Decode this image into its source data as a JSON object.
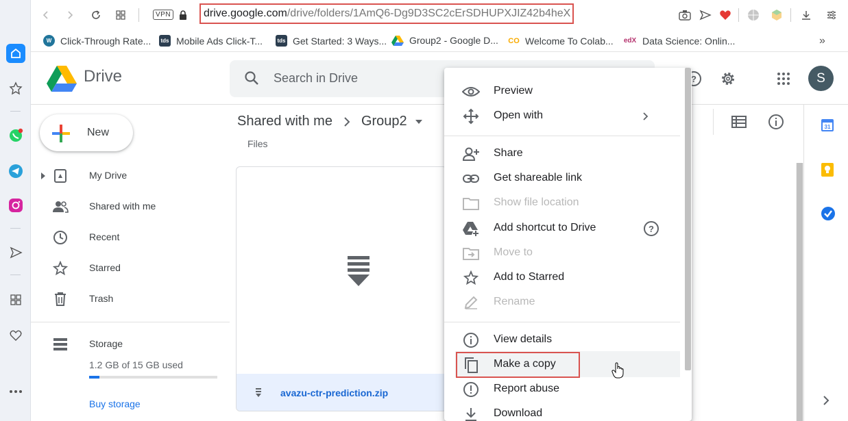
{
  "browser": {
    "url_domain": "drive.google.com",
    "url_path": "/drive/folders/1AmQ6-Dg9D3SC2cErSDHUPXJIZ42b4heX",
    "vpn_label": "VPN",
    "bookmarks": [
      {
        "label": "Click-Through Rate...",
        "icon": "wordpress-icon",
        "color": "#21759b"
      },
      {
        "label": "Mobile Ads Click-T...",
        "icon": "tds-icon",
        "color": "#2c3e50",
        "badge": "tds"
      },
      {
        "label": "Get Started: 3 Ways...",
        "icon": "tds-icon",
        "color": "#2c3e50",
        "badge": "tds"
      },
      {
        "label": "Group2 - Google D...",
        "icon": "google-drive-icon",
        "color": "#0f9d58"
      },
      {
        "label": "Welcome To Colab...",
        "icon": "colab-icon",
        "color": "#f9ab00",
        "badge": "CO"
      },
      {
        "label": "Data Science: Onlin...",
        "icon": "edx-icon",
        "color": "#02262b",
        "badge": "edX"
      }
    ]
  },
  "drive": {
    "title": "Drive",
    "search_placeholder": "Search in Drive",
    "avatar_letter": "S",
    "new_label": "New",
    "nav": [
      {
        "label": "My Drive",
        "icon": "my-drive-icon"
      },
      {
        "label": "Shared with me",
        "icon": "shared-icon"
      },
      {
        "label": "Recent",
        "icon": "clock-icon"
      },
      {
        "label": "Starred",
        "icon": "star-icon"
      },
      {
        "label": "Trash",
        "icon": "trash-icon"
      }
    ],
    "storage_label": "Storage",
    "storage_used": "1.2 GB of 15 GB used",
    "storage_fraction": 0.08,
    "buy_storage": "Buy storage",
    "breadcrumb_root": "Shared with me",
    "breadcrumb_current": "Group2",
    "files_label": "Files",
    "file_name": "avazu-ctr-prediction.zip"
  },
  "menu": {
    "items": [
      {
        "label": "Preview",
        "icon": "eye-icon",
        "disabled": false
      },
      {
        "label": "Open with",
        "icon": "move-arrows-icon",
        "disabled": false
      },
      {
        "label": "Share",
        "icon": "person-add-icon",
        "disabled": false
      },
      {
        "label": "Get shareable link",
        "icon": "link-icon",
        "disabled": false
      },
      {
        "label": "Show file location",
        "icon": "folder-icon",
        "disabled": true
      },
      {
        "label": "Add shortcut to Drive",
        "icon": "drive-shortcut-icon",
        "disabled": false
      },
      {
        "label": "Move to",
        "icon": "move-to-icon",
        "disabled": true
      },
      {
        "label": "Add to Starred",
        "icon": "star-icon",
        "disabled": false
      },
      {
        "label": "Rename",
        "icon": "pencil-icon",
        "disabled": true
      },
      {
        "label": "View details",
        "icon": "info-icon",
        "disabled": false
      },
      {
        "label": "Make a copy",
        "icon": "copy-icon",
        "disabled": false
      },
      {
        "label": "Report abuse",
        "icon": "alert-icon",
        "disabled": false
      },
      {
        "label": "Download",
        "icon": "download-icon",
        "disabled": false
      }
    ]
  },
  "colors": {
    "accent": "#1a73e8",
    "highlight_outline": "#d9534f"
  }
}
